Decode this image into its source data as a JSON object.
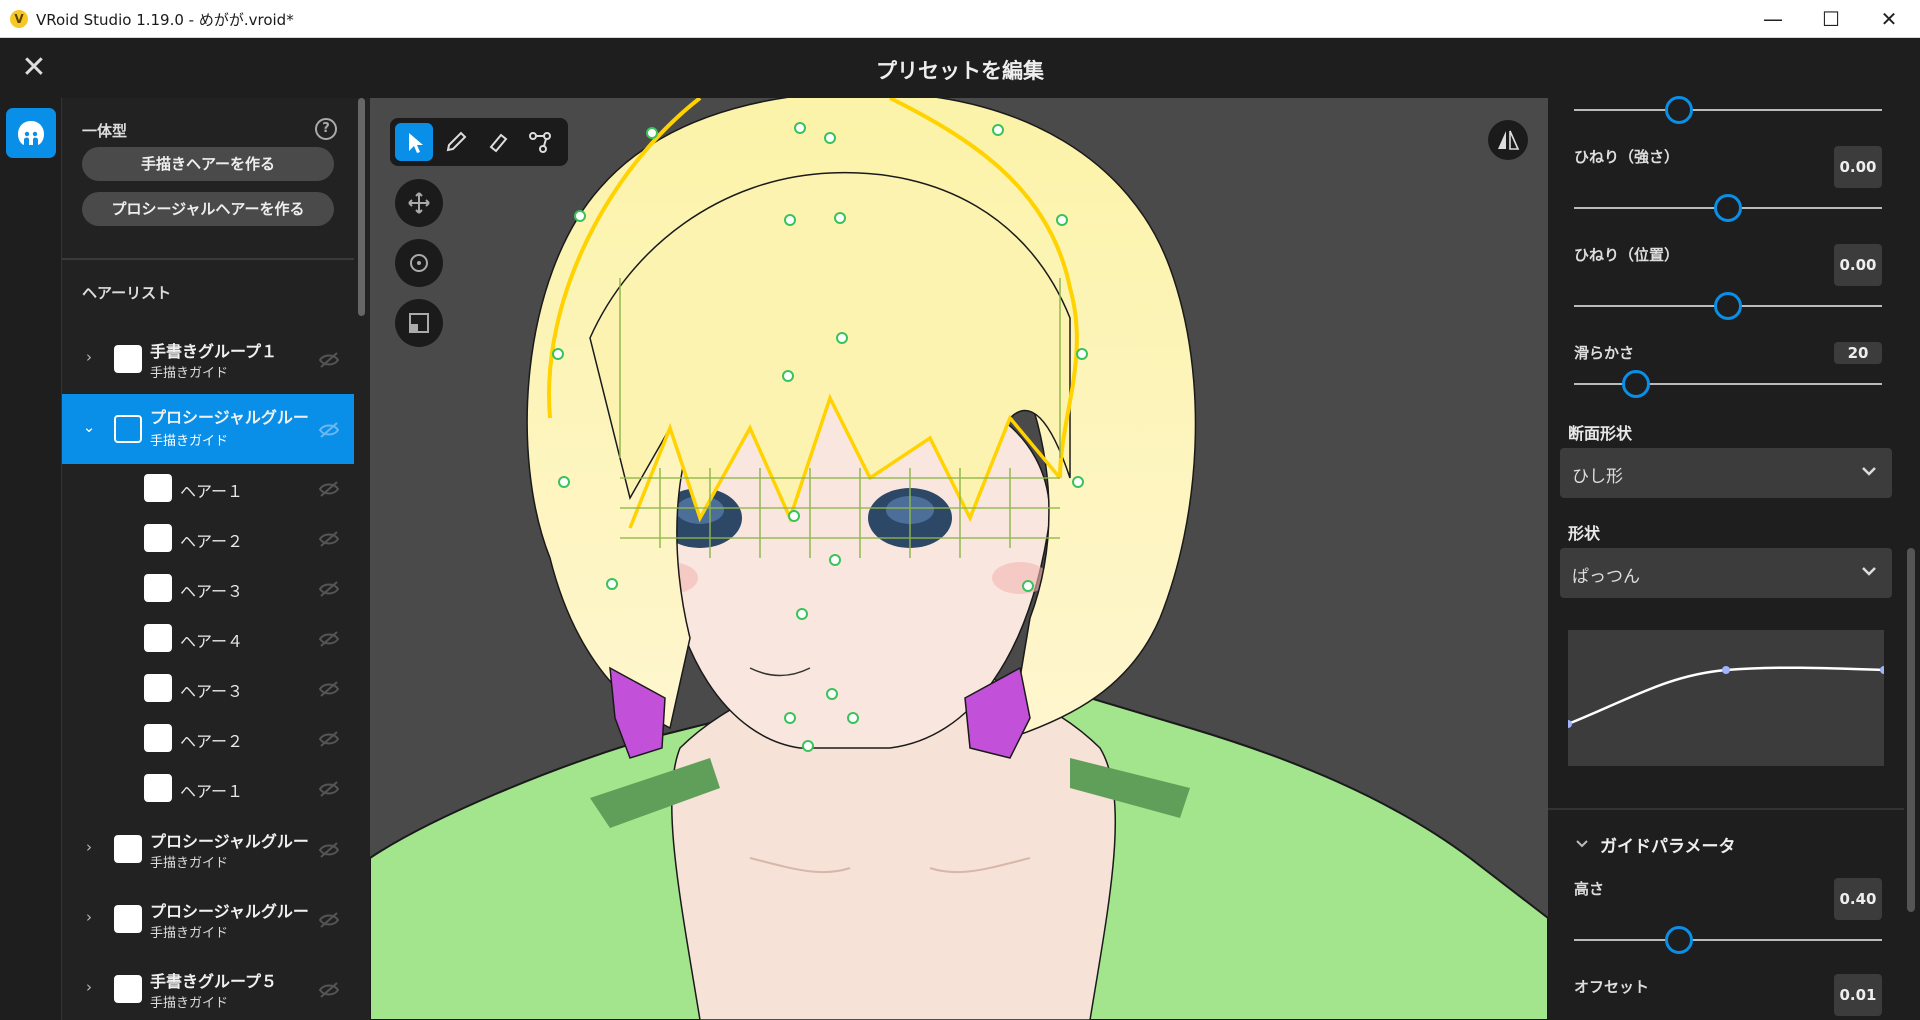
{
  "window": {
    "title": "VRoid Studio 1.19.0 - めがが.vroid*",
    "app_icon_glyph": "V",
    "controls": {
      "minimize": "—",
      "maximize": "☐",
      "close": "✕"
    }
  },
  "header": {
    "close_glyph": "✕",
    "title": "プリセットを編集"
  },
  "left_panel": {
    "section_title": "一体型",
    "help_glyph": "?",
    "buttons": {
      "hand_drawn": "手描きヘアーを作る",
      "procedural": "プロシージャルヘアーを作る"
    },
    "hair_list_title": "ヘアーリスト",
    "groups": [
      {
        "title": "手書きグループ１",
        "subtitle": "手描きガイド",
        "expanded": false,
        "selected": false
      },
      {
        "title": "プロシージャルグルー",
        "subtitle": "手描きガイド",
        "expanded": true,
        "selected": true
      }
    ],
    "children": [
      {
        "title": "ヘアー１"
      },
      {
        "title": "ヘアー２"
      },
      {
        "title": "ヘアー３"
      },
      {
        "title": "ヘアー４"
      },
      {
        "title": "ヘアー３"
      },
      {
        "title": "ヘアー２"
      },
      {
        "title": "ヘアー１"
      }
    ],
    "more_groups": [
      {
        "title": "プロシージャルグルー",
        "subtitle": "手描きガイド"
      },
      {
        "title": "プロシージャルグルー",
        "subtitle": "手描きガイド"
      },
      {
        "title": "手書きグループ５",
        "subtitle": "手描きガイド"
      }
    ]
  },
  "right_panel": {
    "sliders": [
      {
        "label": "",
        "value": "",
        "fraction": 0.34
      },
      {
        "label": "ひねり（強さ）",
        "value": "0.00",
        "fraction": 0.5
      },
      {
        "label": "ひねり（位置）",
        "value": "0.00",
        "fraction": 0.5
      },
      {
        "label": "滑らかさ",
        "value": "20",
        "fraction": 0.2
      }
    ],
    "cross_section": {
      "title": "断面形状",
      "value": "ひし形"
    },
    "shape": {
      "title": "形状",
      "value": "ぱっつん"
    },
    "guide_params": {
      "title": "ガイドパラメータ",
      "height": {
        "label": "高さ",
        "value": "0.40",
        "fraction": 0.34
      },
      "offset": {
        "label": "オフセット",
        "value": "0.01"
      }
    }
  },
  "colors": {
    "accent": "#0a8fe8",
    "hair": "#f6e47a",
    "guide": "#ffd200",
    "outfit": "#9fe58a",
    "ribbon": "#c250d8",
    "skin": "#f7e2d8"
  }
}
